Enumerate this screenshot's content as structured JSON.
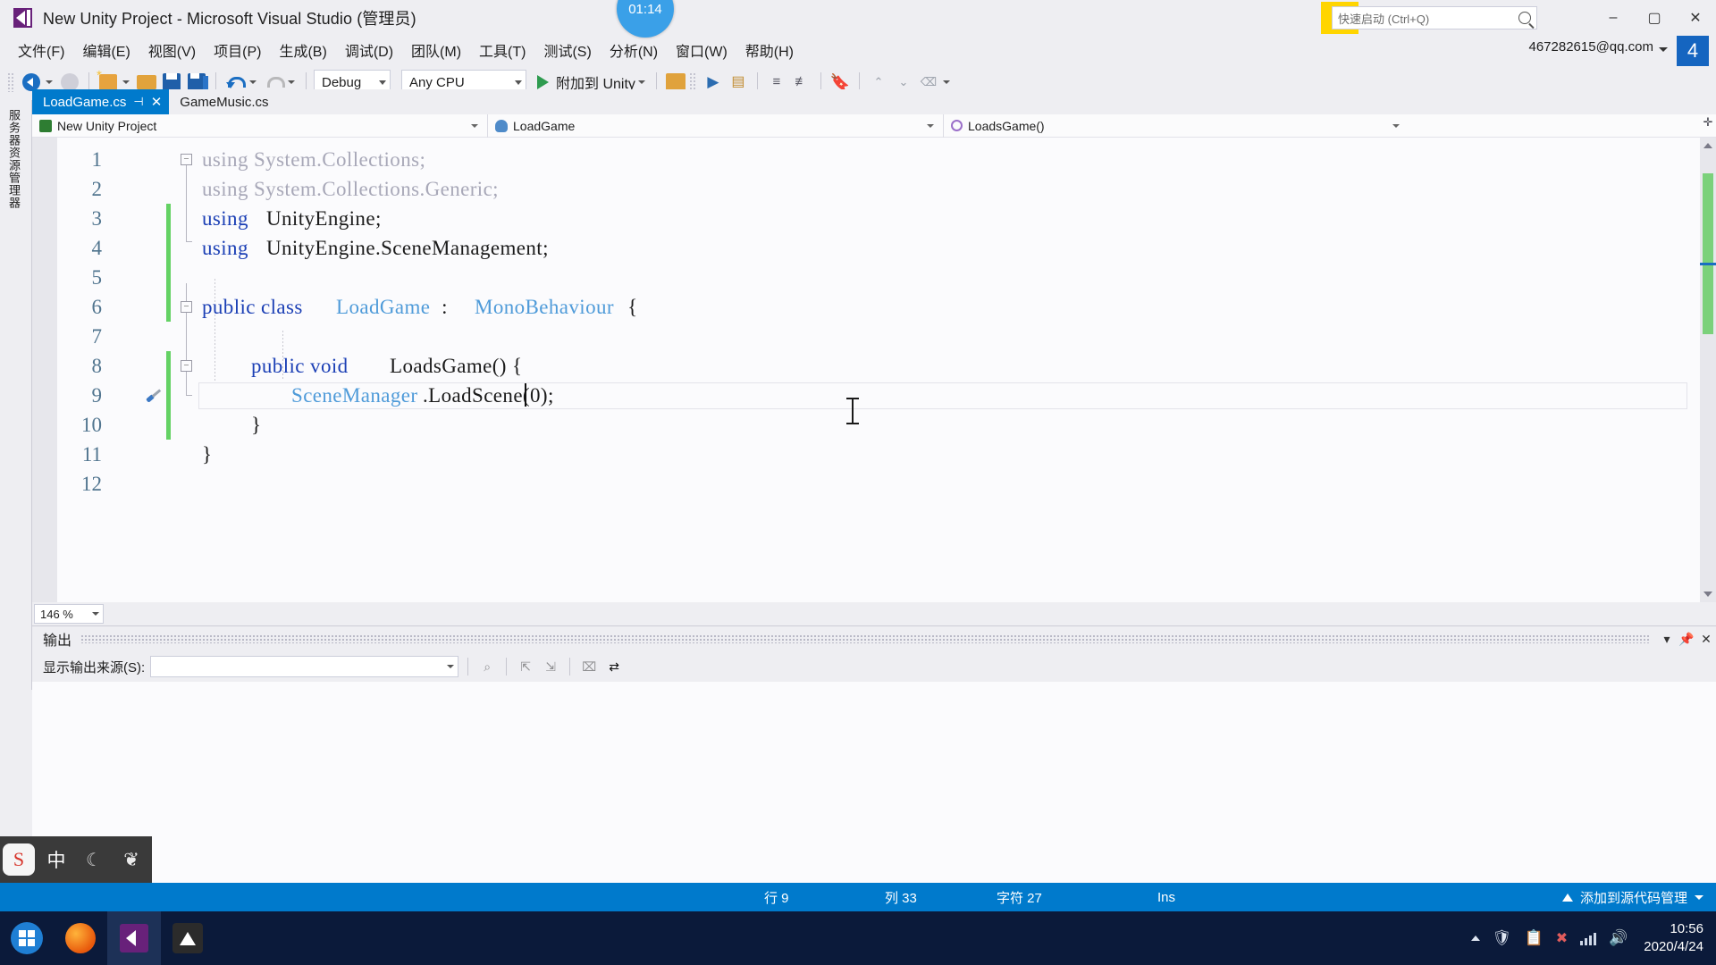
{
  "window": {
    "title": "New Unity Project - Microsoft Visual Studio (管理员)",
    "minimize": "–",
    "maximize": "▢",
    "close": "✕"
  },
  "quick_launch": {
    "placeholder": "快速启动 (Ctrl+Q)",
    "value": "快速启动 (Ctrl+Q)"
  },
  "account": {
    "email": "467282615@qq.com",
    "badge": "4"
  },
  "menubar": {
    "items": [
      {
        "label": "文件(F)"
      },
      {
        "label": "编辑(E)"
      },
      {
        "label": "视图(V)"
      },
      {
        "label": "项目(P)"
      },
      {
        "label": "生成(B)"
      },
      {
        "label": "调试(D)"
      },
      {
        "label": "团队(M)"
      },
      {
        "label": "工具(T)"
      },
      {
        "label": "测试(S)"
      },
      {
        "label": "分析(N)"
      },
      {
        "label": "窗口(W)"
      },
      {
        "label": "帮助(H)"
      }
    ]
  },
  "toolbar": {
    "configuration": "Debug",
    "platform": "Any CPU",
    "attach_label": "附加到 Unity"
  },
  "tabs": [
    {
      "label": "LoadGame.cs",
      "active": true,
      "pin": "⊣",
      "close": "✕"
    },
    {
      "label": "GameMusic.cs",
      "active": false
    }
  ],
  "navbar": {
    "project": "New Unity Project",
    "type": "LoadGame",
    "member": "LoadsGame()"
  },
  "left_rail": {
    "label": "服务器资源管理器"
  },
  "editor": {
    "zoom": "146 %",
    "lines": [
      {
        "number": "1",
        "tokens": [
          {
            "t": "using System.Collections;",
            "c": "dim"
          }
        ]
      },
      {
        "number": "2",
        "tokens": [
          {
            "t": "using System.Collections.Generic;",
            "c": "dim"
          }
        ]
      },
      {
        "number": "3",
        "tokens": [
          {
            "t": "using ",
            "c": "kw"
          },
          {
            "t": "UnityEngine;",
            "c": "plain"
          }
        ]
      },
      {
        "number": "4",
        "tokens": [
          {
            "t": "using ",
            "c": "kw"
          },
          {
            "t": "UnityEngine.SceneManagement;",
            "c": "plain"
          }
        ]
      },
      {
        "number": "5",
        "tokens": []
      },
      {
        "number": "6",
        "tokens": [
          {
            "t": "public class ",
            "c": "kw"
          },
          {
            "t": "LoadGame",
            "c": "type"
          },
          {
            "t": " : ",
            "c": "plain"
          },
          {
            "t": "MonoBehaviour",
            "c": "type"
          },
          {
            "t": " {",
            "c": "plain"
          }
        ]
      },
      {
        "number": "7",
        "tokens": []
      },
      {
        "number": "8",
        "tokens": [
          {
            "t": "public void ",
            "c": "kw"
          },
          {
            "t": "LoadsGame() {",
            "c": "plain"
          }
        ]
      },
      {
        "number": "9",
        "tokens": [
          {
            "t": "SceneManager",
            "c": "type"
          },
          {
            "t": ".LoadScene(0);",
            "c": "plain"
          }
        ]
      },
      {
        "number": "10",
        "tokens": [
          {
            "t": "}",
            "c": "plain"
          }
        ]
      },
      {
        "number": "11",
        "tokens": [
          {
            "t": "}",
            "c": "plain"
          }
        ]
      },
      {
        "number": "12",
        "tokens": []
      }
    ]
  },
  "output": {
    "title": "输出",
    "source_label": "显示输出来源(S):",
    "source_value": "",
    "dropdown_caret": "▾",
    "pin": "📌",
    "close": "✕"
  },
  "statusbar": {
    "line_label": "行 9",
    "column_label": "列 33",
    "char_label": "字符 27",
    "insert_mode": "Ins",
    "source_control": "添加到源代码管理"
  },
  "ime": {
    "sogou": "S",
    "mode": "中",
    "moon": "☾",
    "leaf": "❦"
  },
  "taskbar": {
    "clock_time": "10:56",
    "clock_date": "2020/4/24"
  },
  "overlay": {
    "timer": "01:14"
  },
  "colors": {
    "accent_blue": "#007acc",
    "vs_purple": "#68217a",
    "keyword": "#1b3fb5",
    "type": "#4f9bd9",
    "change_green": "#64d264",
    "chrome_bg": "#eeeef2"
  }
}
